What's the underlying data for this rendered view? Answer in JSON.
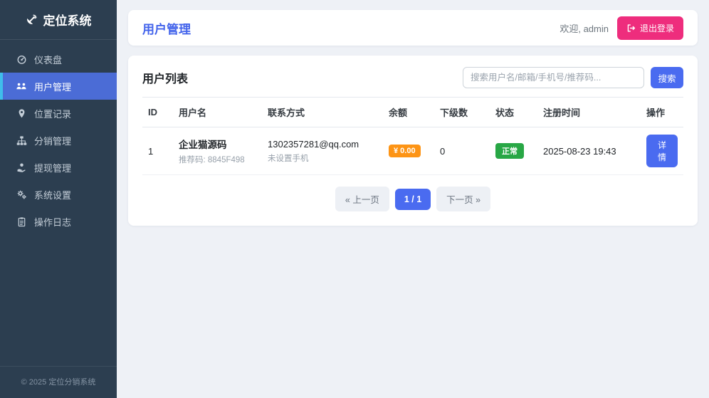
{
  "brand": {
    "title": "定位系统",
    "icon": "satellite-dish-icon"
  },
  "sidebar": {
    "items": [
      {
        "label": "仪表盘",
        "icon": "gauge-icon",
        "active": false
      },
      {
        "label": "用户管理",
        "icon": "users-icon",
        "active": true
      },
      {
        "label": "位置记录",
        "icon": "map-marker-icon",
        "active": false
      },
      {
        "label": "分销管理",
        "icon": "sitemap-icon",
        "active": false
      },
      {
        "label": "提现管理",
        "icon": "withdraw-icon",
        "active": false
      },
      {
        "label": "系统设置",
        "icon": "gears-icon",
        "active": false
      },
      {
        "label": "操作日志",
        "icon": "log-icon",
        "active": false
      }
    ],
    "footer": "© 2025 定位分销系统"
  },
  "header": {
    "title": "用户管理",
    "welcome": "欢迎, admin",
    "logout_label": "退出登录"
  },
  "panel": {
    "title": "用户列表",
    "search": {
      "placeholder": "搜索用户名/邮箱/手机号/推荐码...",
      "button_label": "搜索"
    }
  },
  "table": {
    "headers": [
      "ID",
      "用户名",
      "联系方式",
      "余额",
      "下级数",
      "状态",
      "注册时间",
      "操作"
    ],
    "rows": [
      {
        "id": "1",
        "username": "企业猫源码",
        "referral": "推荐码: 8845F498",
        "email": "1302357281@qq.com",
        "phone": "未设置手机",
        "balance": "¥ 0.00",
        "subordinates": "0",
        "status": "正常",
        "registered": "2025-08-23 19:43",
        "action_label": "详情"
      }
    ]
  },
  "pagination": {
    "prev": "« 上一页",
    "current": "1 / 1",
    "next": "下一页 »"
  },
  "colors": {
    "sidebar_bg": "#2c3e50",
    "active_item_bg": "#4b6cd6",
    "active_item_border": "#3fbdeb",
    "title_blue": "#4263eb",
    "accent_blue": "#4a6bf0",
    "logout_pink": "#ee2d7d",
    "balance_orange": "#fd9415",
    "status_green": "#28a745",
    "page_bg": "#eef1f6"
  }
}
